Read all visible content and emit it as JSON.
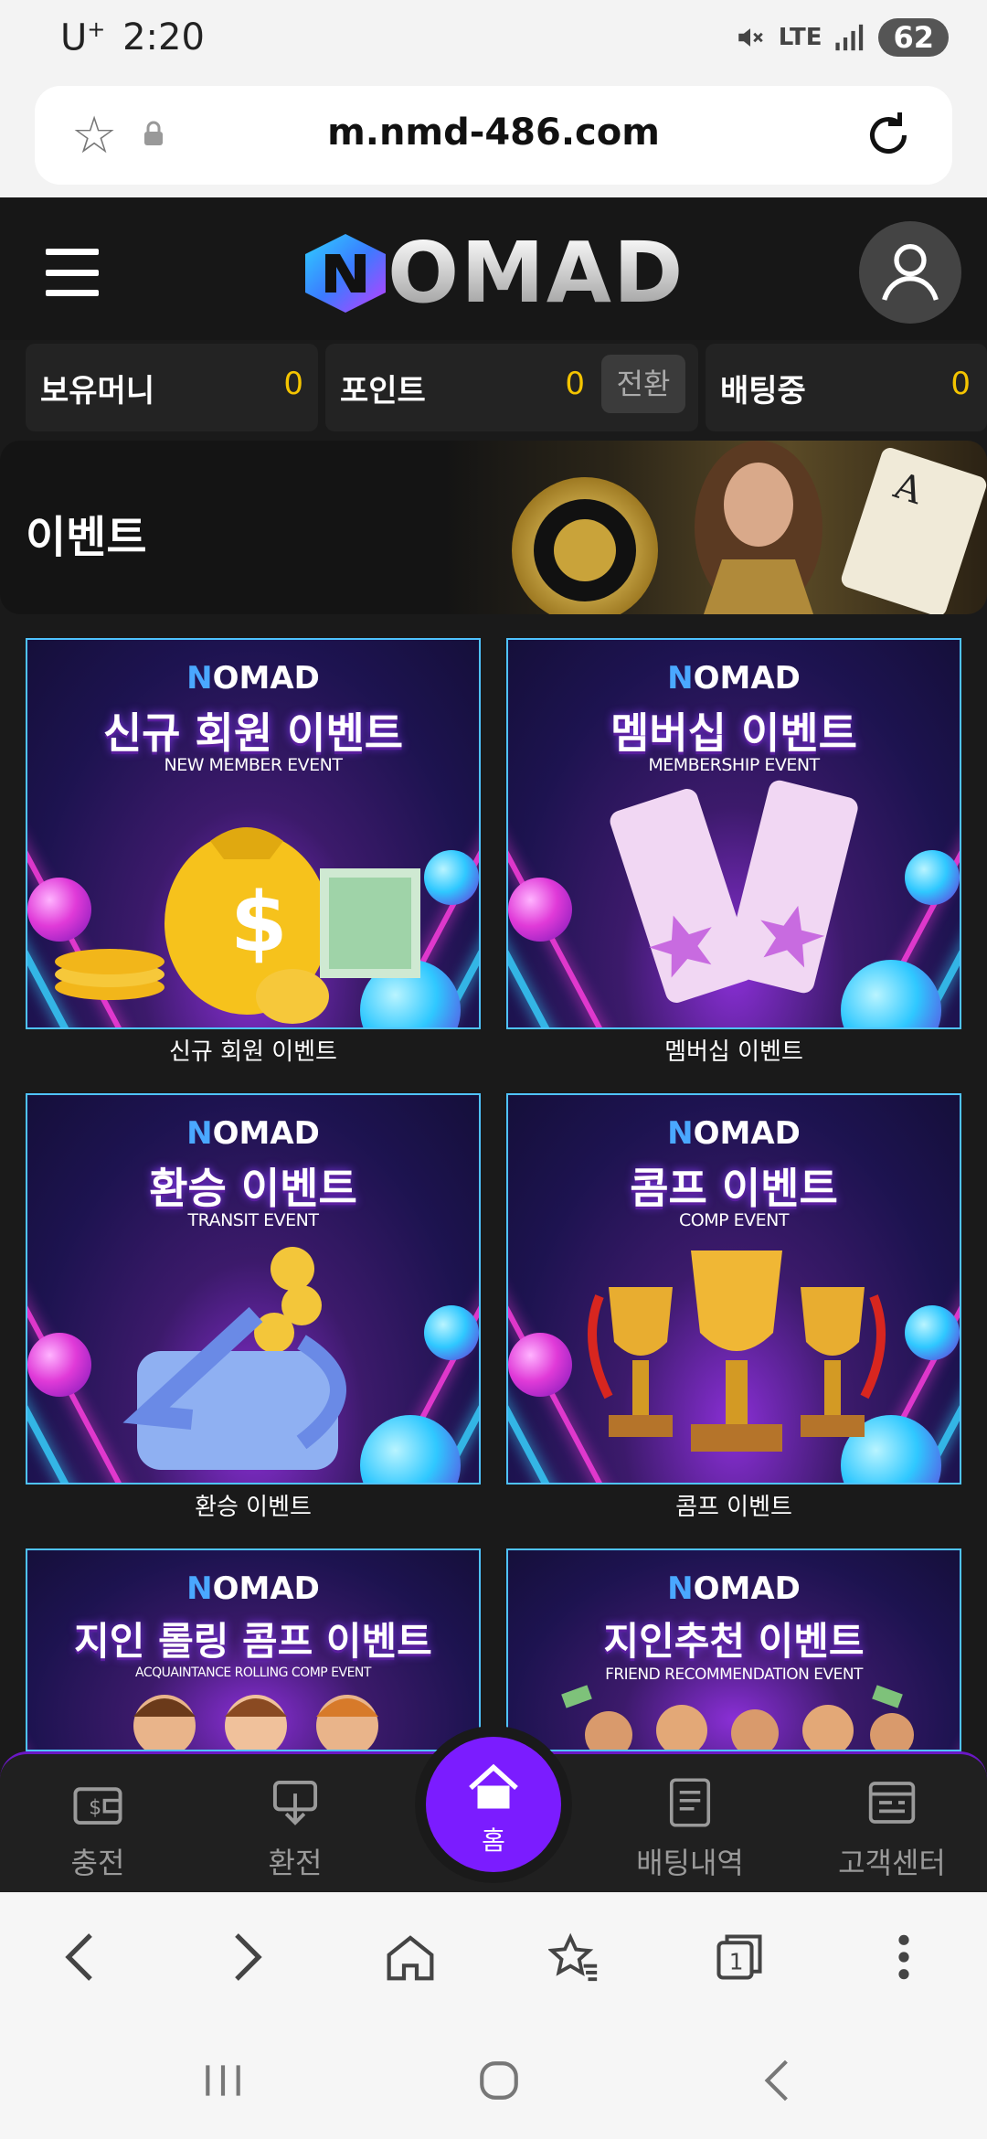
{
  "status_bar": {
    "carrier": "U",
    "carrier_sup": "+",
    "time": "2:20",
    "network": "LTE",
    "battery": "62"
  },
  "browser": {
    "url": "m.nmd-486.com"
  },
  "site": {
    "logo_text": "OMAD",
    "balances": [
      {
        "label": "보유머니",
        "value": "0"
      },
      {
        "label": "포인트",
        "value": "0"
      },
      {
        "label": "배팅중",
        "value": "0"
      }
    ],
    "convert_label": "전환",
    "event_title": "이벤트"
  },
  "events": [
    {
      "brand": "OMAD",
      "heading": "신규 회원 이벤트",
      "sub": "NEW MEMBER EVENT",
      "caption": "신규 회원 이벤트"
    },
    {
      "brand": "OMAD",
      "heading": "멤버십 이벤트",
      "sub": "MEMBERSHIP EVENT",
      "caption": "멤버십 이벤트"
    },
    {
      "brand": "OMAD",
      "heading": "환승 이벤트",
      "sub": "TRANSIT EVENT",
      "caption": "환승 이벤트"
    },
    {
      "brand": "OMAD",
      "heading": "콤프 이벤트",
      "sub": "COMP EVENT",
      "caption": "콤프 이벤트"
    },
    {
      "brand": "OMAD",
      "heading": "지인 롤링 콤프 이벤트",
      "sub": "ACQUAINTANCE ROLLING COMP EVENT",
      "caption": ""
    },
    {
      "brand": "OMAD",
      "heading": "지인추천 이벤트",
      "sub": "FRIEND RECOMMENDATION EVENT",
      "caption": ""
    }
  ],
  "bottom_nav": {
    "deposit": "충전",
    "withdraw": "환전",
    "home": "홈",
    "bet_history": "배팅내역",
    "support": "고객센터"
  },
  "browser_bar": {
    "tab_count": "1"
  },
  "colors": {
    "accent_purple": "#7b1cff",
    "balance_yellow": "#f4c400",
    "card_border": "#4fc3ff"
  }
}
